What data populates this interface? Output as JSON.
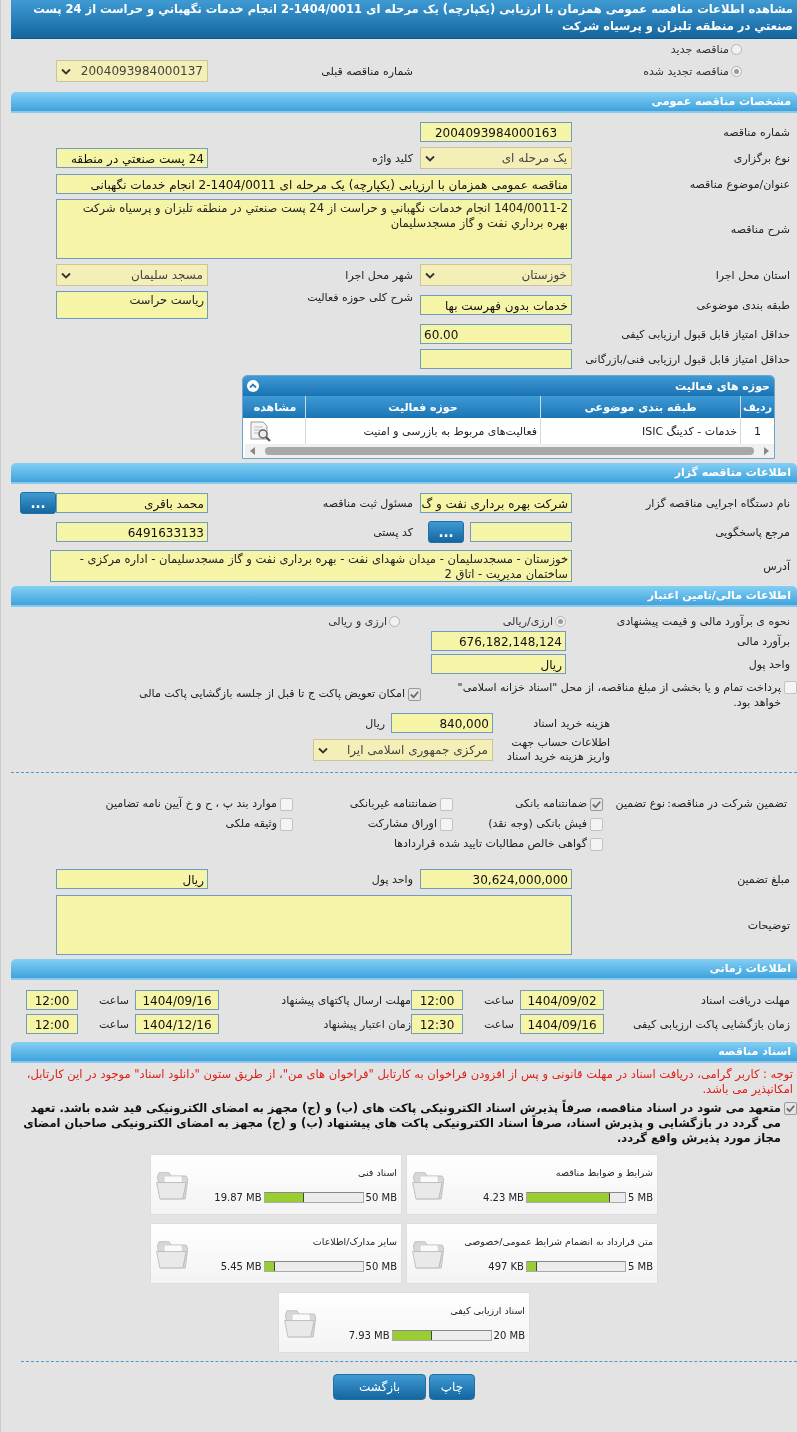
{
  "page_title": "مشاهده اطلاعات مناقصه عمومی همزمان با ارزیابی (یکپارچه) یک مرحله ای 1404/0011-2 انجام خدمات نگهباني و حراست از 24 پست صنعتي در منطقه تلبزان و پرسياه شرکت",
  "tender_kind": [
    {
      "label": "مناقصه جدید",
      "selected": false
    },
    {
      "label": "مناقصه تجدید شده",
      "selected": true
    }
  ],
  "previous_tender": {
    "label": "شماره مناقصه قبلی",
    "value": "2004093984000137"
  },
  "general": {
    "heading": "مشخصات مناقصه عمومی",
    "tender_number": {
      "label": "شماره مناقصه",
      "value": "2004093984000163"
    },
    "holding_type": {
      "label": "نوع برگزاری",
      "value": "یک مرحله ای"
    },
    "keyword": {
      "label": "کلید واژه",
      "value": "24 پست صنعتي در منطقه"
    },
    "subject": {
      "label": "عنوان/موضوع مناقصه",
      "value": "مناقصه عمومی همزمان با ارزیابی (یکپارچه) یک مرحله ای 1404/0011-2 انجام خدمات نگهبانی"
    },
    "description": {
      "label": "شرح مناقصه",
      "value": "1404/0011-2 انجام خدمات نگهباني و حراست از 24 پست صنعتي در منطقه تلبزان و پرسياه شرکت بهره برداري نفت و گاز مسجدسليمان"
    },
    "province": {
      "label": "استان محل اجرا",
      "value": "خوزستان"
    },
    "city": {
      "label": "شهر محل اجرا",
      "value": "مسجد سلیمان"
    },
    "category": {
      "label": "طبقه بندی موضوعی",
      "value": "خدمات بدون فهرست بها"
    },
    "activity_scope": {
      "label": "شرح کلی حوزه فعالیت",
      "value": "ریاست حراست"
    },
    "min_quality_score": {
      "label": "حداقل امتیاز قابل قبول ارزیابی کیفی",
      "value": "60.00"
    },
    "min_technical_score": {
      "label": "حداقل امتیاز قابل قبول ارزیابی فنی/بازرگانی"
    },
    "activity_table": {
      "title": "حوزه های فعالیت",
      "columns": [
        "ردیف",
        "طبقه بندی موضوعی",
        "حوزه فعالیت",
        "مشاهده"
      ],
      "rows": [
        [
          "1",
          "خدمات - کدینگ ISIC",
          "فعالیت‌های مربوط به بازرسی و امنیت"
        ]
      ]
    }
  },
  "organizer": {
    "heading": "اطلاعات مناقصه گزار",
    "executive_body": {
      "label": "نام دستگاه اجرایی مناقصه گزار",
      "value": "شرکت بهره برداری نفت و گ"
    },
    "registrar": {
      "label": "مسئول ثبت مناقصه",
      "value": "محمد باقری",
      "button": "..."
    },
    "reference": {
      "label": "مرجع پاسخگویی",
      "button": "..."
    },
    "postal_code": {
      "label": "کد پستی",
      "value": "6491633133"
    },
    "address": {
      "label": "آدرس",
      "value": "خوزستان - مسجدسلیمان - میدان شهدای نفت - بهره برداری نفت و گاز مسجدسلیمان - اداره مرکزی - ساختمان مدیریت - اتاق 2"
    }
  },
  "financial": {
    "heading": "اطلاعات مالی/تامین اعتبار",
    "price_method": {
      "label": "نحوه ی برآورد مالی و قیمت پیشنهادی",
      "options": [
        {
          "label": "ارزی/ریالی",
          "selected": true
        },
        {
          "label": "ارزی و ریالی",
          "selected": false
        }
      ]
    },
    "estimate": {
      "label": "برآورد مالی",
      "value": "676,182,148,124"
    },
    "currency": {
      "label": "واحد پول",
      "value": "ریال"
    },
    "checks": [
      {
        "label": "پرداخت تمام و یا بخشی از مبلغ مناقصه، از محل \"اسناد خزانه اسلامی\" خواهد بود.",
        "checked": false
      },
      {
        "label": "امکان تعویض پاکت ج تا قبل از جلسه بازگشایی پاکت مالی",
        "checked": true
      }
    ],
    "document_fee": {
      "label": "هزینه خرید اسناد",
      "value": "840,000",
      "unit": "ریال"
    },
    "fee_account": {
      "label": "اطلاعات حساب جهت واریز هزینه خرید اسناد",
      "value": "مرکزی جمهوری اسلامی ایرا"
    },
    "guarantee": {
      "label": "تضمین شرکت در مناقصه:",
      "type_label": "نوع تضمین",
      "options": [
        {
          "label": "ضمانتنامه بانکی",
          "checked": true
        },
        {
          "label": "ضمانتنامه غیربانکی",
          "checked": false
        },
        {
          "label": "موارد بند پ ، ح و خ آیین نامه تضامین",
          "checked": false
        },
        {
          "label": "فیش بانکی (وجه نقد)",
          "checked": false
        },
        {
          "label": "اوراق مشارکت",
          "checked": false
        },
        {
          "label": "وثیقه ملکی",
          "checked": false
        },
        {
          "label": "گواهی خالص مطالبات تایید شده قراردادها",
          "checked": false
        }
      ]
    },
    "guarantee_amount": {
      "label": "مبلغ تضمین",
      "value": "30,624,000,000"
    },
    "guarantee_currency": {
      "label": "واحد پول",
      "value": "ریال"
    },
    "notes": {
      "label": "توضیحات"
    }
  },
  "timing": {
    "heading": "اطلاعات زمانی",
    "rows": [
      {
        "label": "مهلت دریافت اسناد",
        "date": "1404/09/02",
        "time_label": "ساعت",
        "time": "12:00"
      },
      {
        "label": "مهلت ارسال پاکتهای پیشنهاد",
        "date": "1404/09/16",
        "time_label": "ساعت",
        "time": "12:00"
      },
      {
        "label": "زمان بازگشایی پاکت ارزیابی کیفی",
        "date": "1404/09/16",
        "time_label": "ساعت",
        "time": "12:30"
      },
      {
        "label": "زمان اعتبار پیشنهاد",
        "date": "1404/12/16",
        "time_label": "ساعت",
        "time": "12:00"
      }
    ]
  },
  "documents": {
    "heading": "اسناد مناقصه",
    "notice": "توجه : کاربر گرامی، دریافت اسناد در مهلت قانونی و پس از افزودن فراخوان به کارتابل \"فراخوان های من\"، از طریق ستون \"دانلود اسناد\" موجود در این کارتابل، امکانپذیر می باشد.",
    "commitment": {
      "checked": true,
      "text": "متعهد می شود در اسناد مناقصه، صرفاً پذیرش اسناد الکترونیکی پاکت های (ب) و (ج) مجهز به امضای الکترونیکی قید شده باشد. تعهد می گردد در بازگشایی و پذیرش اسناد، صرفاً اسناد الکترونیکی پاکت های پیشنهاد (ب) و (ج) مجهز به امضای الکترونیکی صاحبان امضای مجاز مورد پذیرش واقع گردد."
    },
    "files": [
      {
        "title": "شرایط و ضوابط مناقصه",
        "size": "4.23 MB",
        "max": "5 MB",
        "level": 0.85
      },
      {
        "title": "اسناد فنی",
        "size": "19.87 MB",
        "max": "50 MB",
        "level": 0.4
      },
      {
        "title": "متن قرارداد به انضمام شرایط عمومی/خصوصی",
        "size": "497 KB",
        "max": "5 MB",
        "level": 0.1
      },
      {
        "title": "سایر مدارک/اطلاعات",
        "size": "5.45 MB",
        "max": "50 MB",
        "level": 0.11
      },
      {
        "title": "اسناد ارزیابی کیفی",
        "size": "7.93 MB",
        "max": "20 MB",
        "level": 0.4
      }
    ]
  },
  "buttons": [
    {
      "label": "چاپ"
    },
    {
      "label": "بازگشت"
    }
  ]
}
